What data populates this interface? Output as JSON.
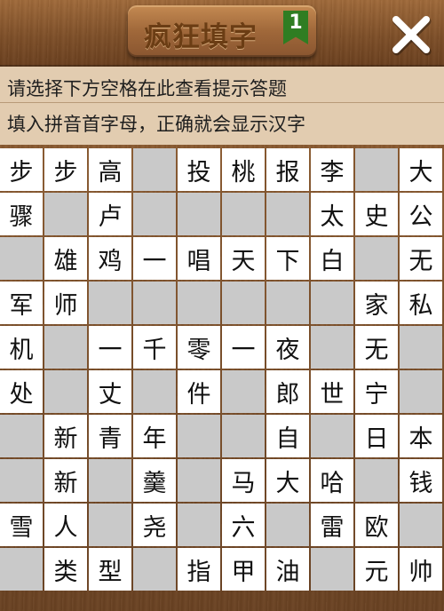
{
  "header": {
    "title": "疯狂填字",
    "level": "1"
  },
  "hints": {
    "line1": "请选择下方空格在此查看提示答题",
    "line2": "填入拼音首字母，正确就会显示汉字"
  },
  "colors": {
    "header_wood": "#7e4f28",
    "hint_background": "#e2ccb0",
    "blocked_cell": "#c9c9c9",
    "open_cell": "#ffffff",
    "level_badge": "#2f7d22"
  },
  "icons": {
    "close": "close-icon"
  },
  "grid": {
    "rows": [
      [
        "步",
        "步",
        "高",
        null,
        "投",
        "桃",
        "报",
        "李",
        null,
        "大"
      ],
      [
        "骤",
        null,
        "卢",
        null,
        null,
        null,
        null,
        "太",
        "史",
        "公"
      ],
      [
        null,
        "雄",
        "鸡",
        "一",
        "唱",
        "天",
        "下",
        "白",
        null,
        "无"
      ],
      [
        "军",
        "师",
        null,
        null,
        null,
        null,
        null,
        null,
        "家",
        "私"
      ],
      [
        "机",
        null,
        "一",
        "千",
        "零",
        "一",
        "夜",
        null,
        "无",
        null
      ],
      [
        "处",
        null,
        "丈",
        null,
        "件",
        null,
        "郎",
        "世",
        "宁",
        null
      ],
      [
        null,
        "新",
        "青",
        "年",
        null,
        null,
        "自",
        null,
        "日",
        "本"
      ],
      [
        null,
        "新",
        null,
        "羹",
        null,
        "马",
        "大",
        "哈",
        null,
        "钱"
      ],
      [
        "雪",
        "人",
        null,
        "尧",
        null,
        "六",
        null,
        "雷",
        "欧",
        null
      ],
      [
        null,
        "类",
        "型",
        null,
        "指",
        "甲",
        "油",
        null,
        "元",
        "帅"
      ]
    ]
  }
}
